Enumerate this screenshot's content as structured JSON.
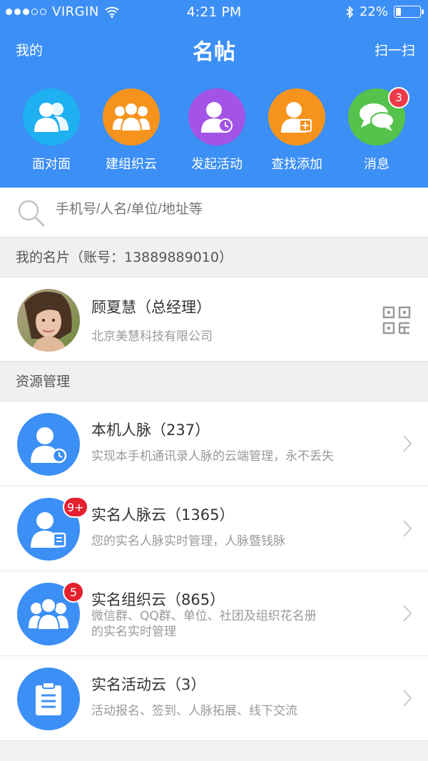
{
  "status_bar": {
    "carrier": "VIRGIN",
    "time": "4:21 PM",
    "battery": "22%",
    "battery_level": 0.22
  },
  "nav": {
    "left": "我的",
    "title": "名帖",
    "right": "扫一扫"
  },
  "quick_actions": [
    {
      "label": "面对面",
      "icon": "two-people-icon",
      "color": "#1fb0f1"
    },
    {
      "label": "建组织云",
      "icon": "group-icon",
      "color": "#f6931d"
    },
    {
      "label": "发起活动",
      "icon": "person-clock-icon",
      "color": "#a353e6"
    },
    {
      "label": "查找添加",
      "icon": "person-add-icon",
      "color": "#f6931d"
    },
    {
      "label": "消息",
      "icon": "chat-bubbles-icon",
      "color": "#55c24c",
      "badge": "3"
    }
  ],
  "search": {
    "placeholder": "手机号/人名/单位/地址等"
  },
  "my_card": {
    "header": "我的名片（账号：13889889010）",
    "name": "顾夏慧（总经理）",
    "company": "北京美慧科技有限公司"
  },
  "resource": {
    "header": "资源管理",
    "items": [
      {
        "title": "本机人脉（237）",
        "desc": "实现本手机通讯录人脉的云端管理，永不丢失",
        "icon": "person-clock-icon"
      },
      {
        "title": "实名人脉云（1365）",
        "desc": "您的实名人脉实时管理，人脉暨钱脉",
        "icon": "person-id-icon",
        "badge": "9+"
      },
      {
        "title": "实名组织云（865）",
        "desc": "微信群、QQ群、单位、社团及组织花名册",
        "desc2": "的实名实时管理",
        "icon": "group-icon",
        "badge": "5"
      },
      {
        "title": "实名活动云（3）",
        "desc": "活动报名、签到、人脉拓展、线下交流",
        "icon": "clipboard-icon"
      }
    ]
  },
  "colors": {
    "primary": "#3c8ff5",
    "badge": "#e5202f"
  }
}
